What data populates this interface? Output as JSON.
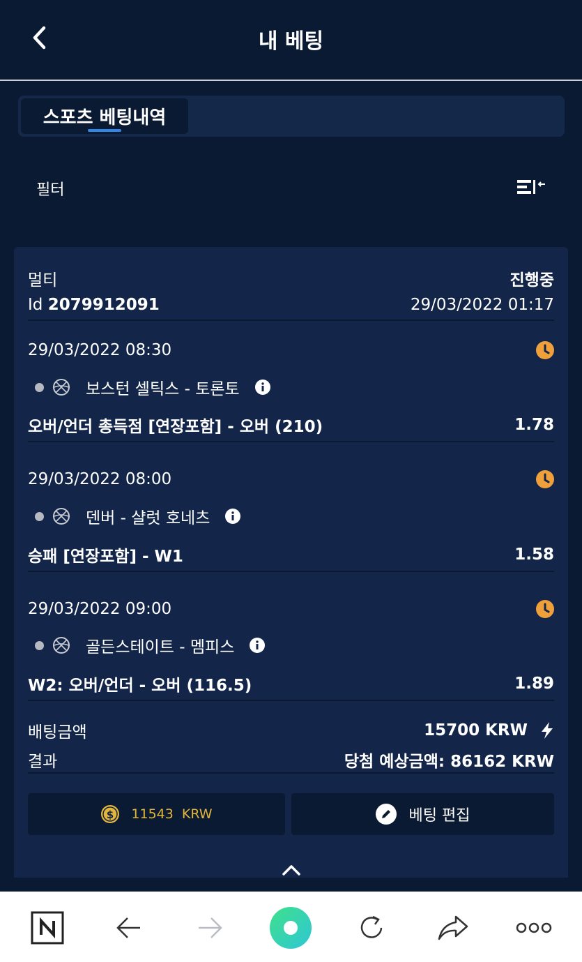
{
  "header": {
    "title": "내 베팅",
    "back_icon": "chevron-left-icon"
  },
  "tabs": [
    {
      "label": "스포츠 베팅내역",
      "active": true
    }
  ],
  "filter": {
    "label": "필터",
    "sort_icon": "sort-list-icon"
  },
  "bet": {
    "type": "멀티",
    "status": "진행중",
    "id_label": "Id",
    "id_value": "2079912091",
    "placed_at": "29/03/2022 01:17",
    "events": [
      {
        "datetime": "29/03/2022 08:30",
        "match": "보스턴 셀틱스 - 토론토",
        "selection": "오버/언더 총득점 [연장포함] - 오버 (210)",
        "odds": "1.78"
      },
      {
        "datetime": "29/03/2022 08:00",
        "match": "덴버 - 샬럿 호네츠",
        "selection": "승패 [연장포함] - W1",
        "odds": "1.58"
      },
      {
        "datetime": "29/03/2022 09:00",
        "match": "골든스테이트 - 멤피스",
        "selection": "W2: 오버/언더 - 오버 (116.5)",
        "odds": "1.89"
      }
    ],
    "stake_label": "배팅금액",
    "stake_value": "15700 KRW",
    "result_label": "결과",
    "result_value": "당첨 예상금액: 86162 KRW",
    "balance_button": "11543  KRW",
    "edit_button": "베팅 편집"
  },
  "colors": {
    "background": "#0b1a33",
    "card": "#13264a",
    "accent_blue": "#2f86e6",
    "clock_orange": "#f0a03a",
    "gold": "#e3b53a"
  }
}
